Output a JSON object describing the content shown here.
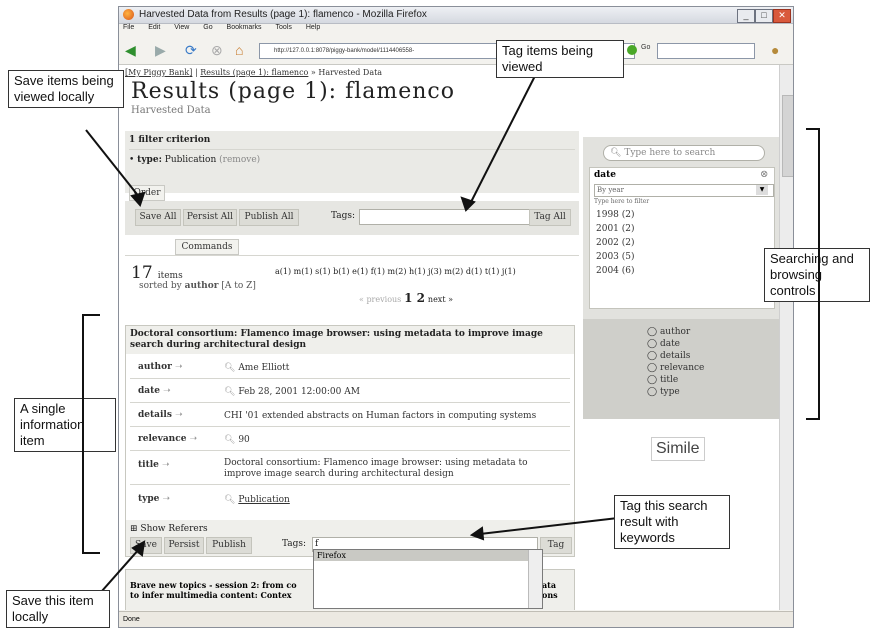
{
  "window": {
    "title": "Harvested Data from Results (page 1): flamenco - Mozilla Firefox",
    "menu": [
      "File",
      "Edit",
      "View",
      "Go",
      "Bookmarks",
      "Tools",
      "Help"
    ],
    "url": "http://127.0.0.1:8078/piggy-bank/model/1114406558-",
    "go_label": "Go",
    "status": "Done"
  },
  "page": {
    "breadcrumb_home": "My Piggy Bank",
    "breadcrumb_results": "Results (page 1): flamenco",
    "breadcrumb_current": "» Harvested Data",
    "breadcrumb_sep": "|",
    "title": "Results (page 1): flamenco",
    "subtitle": "Harvested Data",
    "filter_heading": "1 filter criterion",
    "filter_item_key": "type:",
    "filter_item_value": "Publication",
    "filter_remove": "(remove)",
    "order_tab": "Order",
    "commands_tab": "Commands",
    "save_all": "Save All",
    "persist_all": "Persist All",
    "publish_all": "Publish All",
    "tags_label": "Tags:",
    "tag_all": "Tag All",
    "count": "17",
    "items_label": "items",
    "sorted_by": "sorted by",
    "sort_field": "author",
    "sort_order": "[A to Z]",
    "letters": "a(1) m(1) s(1) b(1) e(1) f(1) m(2) h(1) j(3) m(2) d(1) t(1) j(1)",
    "prev": "« previous",
    "pages": "1 2",
    "next": "next »"
  },
  "item": {
    "title": "Doctoral consortium: Flamenco image browser: using metadata to improve image search during architectural design",
    "props": [
      {
        "name": "author",
        "value": "Ame Elliott",
        "link": false
      },
      {
        "name": "date",
        "value": "Feb 28, 2001 12:00:00 AM",
        "link": false
      },
      {
        "name": "details",
        "value": "CHI '01 extended abstracts on Human factors in computing systems",
        "link": false
      },
      {
        "name": "relevance",
        "value": "90",
        "link": false
      },
      {
        "name": "title",
        "value": "Doctoral consortium: Flamenco image browser: using metadata to improve image search during architectural design",
        "link": false
      },
      {
        "name": "type",
        "value": "Publication",
        "link": true
      }
    ],
    "show_referers": "Show Referers",
    "save": "Save",
    "persist": "Persist",
    "publish": "Publish",
    "tags_label": "Tags:",
    "tags_value": "f",
    "tag": "Tag",
    "autocomplete_option": "Firefox"
  },
  "next_item": {
    "title_line1": "Brave new topics - session 2: from co",
    "title_line2": "to infer multimedia content: Contex",
    "tail1": "ata",
    "tail2": "ons"
  },
  "right": {
    "search_placeholder": "Type here to search",
    "facet_title": "date",
    "facet_sort": "By year",
    "facet_filter_placeholder": "Type here to filter",
    "facet_values": [
      "1998 (2)",
      "2001 (2)",
      "2002 (2)",
      "2003 (5)",
      "2004 (6)"
    ],
    "props": [
      "author",
      "date",
      "details",
      "relevance",
      "title",
      "type"
    ],
    "logo": "Simile"
  },
  "annotations": {
    "save_items": "Save items being viewed locally",
    "tag_items": "Tag items being viewed",
    "searching": "Searching and browsing controls",
    "single_item": "A single information item",
    "tag_result": "Tag this search result with keywords",
    "save_item": "Save this item locally"
  }
}
